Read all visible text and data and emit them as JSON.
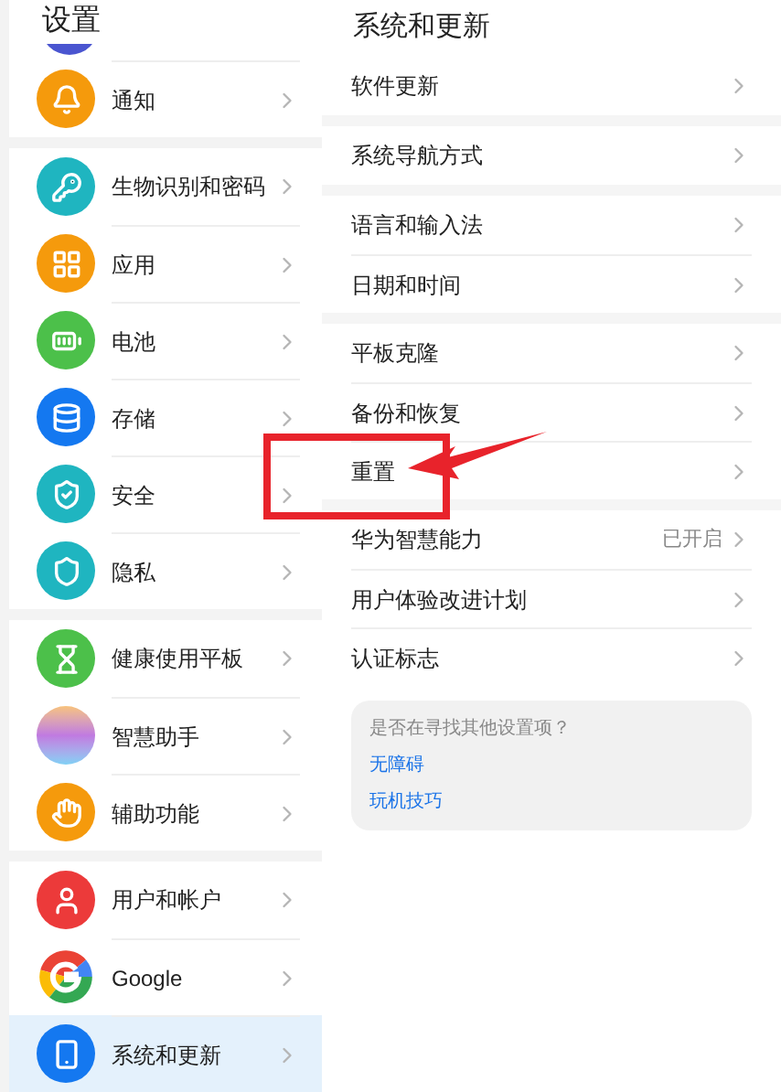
{
  "sidebar": {
    "title": "设置",
    "groups": [
      {
        "items": [
          {
            "label": "通知",
            "selected": false
          }
        ]
      },
      {
        "items": [
          {
            "label": "生物识别和密码",
            "selected": false
          },
          {
            "label": "应用",
            "selected": false
          },
          {
            "label": "电池",
            "selected": false
          },
          {
            "label": "存储",
            "selected": false
          },
          {
            "label": "安全",
            "selected": false
          },
          {
            "label": "隐私",
            "selected": false
          }
        ]
      },
      {
        "items": [
          {
            "label": "健康使用平板",
            "selected": false
          },
          {
            "label": "智慧助手",
            "selected": false
          },
          {
            "label": "辅助功能",
            "selected": false
          }
        ]
      },
      {
        "items": [
          {
            "label": "用户和帐户",
            "selected": false
          },
          {
            "label": "Google",
            "selected": false
          },
          {
            "label": "系统和更新",
            "selected": true
          }
        ]
      }
    ]
  },
  "detail": {
    "title": "系统和更新",
    "groups": [
      {
        "items": [
          {
            "label": "软件更新"
          }
        ]
      },
      {
        "items": [
          {
            "label": "系统导航方式"
          }
        ]
      },
      {
        "items": [
          {
            "label": "语言和输入法"
          },
          {
            "label": "日期和时间"
          }
        ]
      },
      {
        "items": [
          {
            "label": "平板克隆"
          },
          {
            "label": "备份和恢复"
          },
          {
            "label": "重置"
          }
        ]
      },
      {
        "items": [
          {
            "label": "华为智慧能力",
            "value": "已开启"
          },
          {
            "label": "用户体验改进计划"
          },
          {
            "label": "认证标志"
          }
        ]
      }
    ],
    "suggestions": {
      "question": "是否在寻找其他设置项？",
      "links": [
        "无障碍",
        "玩机技巧"
      ]
    }
  }
}
